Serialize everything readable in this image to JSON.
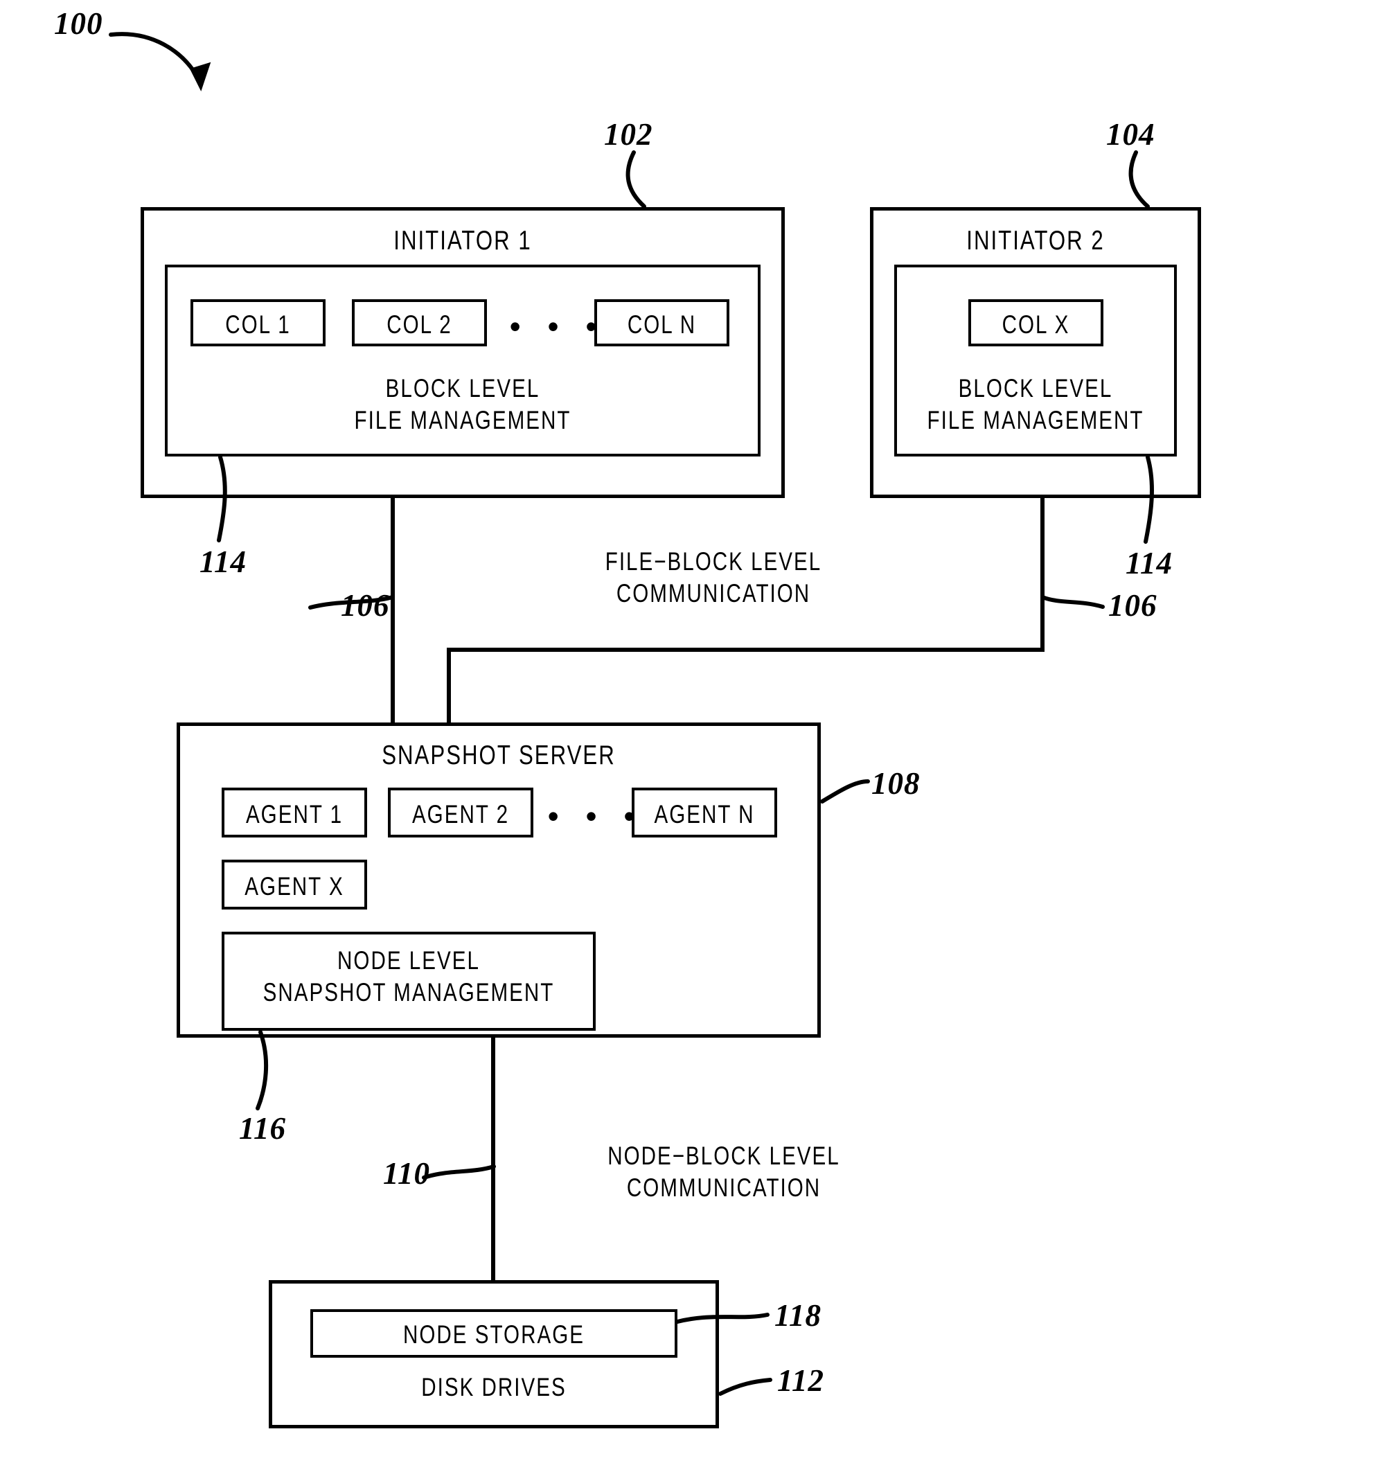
{
  "figure": {
    "figure_number": "100",
    "blocks": {
      "initiator1": {
        "title": "INITIATOR 1",
        "ref": "102",
        "inner_ref": "114",
        "inner_title_line1": "BLOCK LEVEL",
        "inner_title_line2": "FILE MANAGEMENT",
        "cols": [
          "COL 1",
          "COL 2",
          "COL N"
        ],
        "ellipsis": "• • •"
      },
      "initiator2": {
        "title": "INITIATOR 2",
        "ref": "104",
        "inner_ref": "114",
        "inner_title_line1": "BLOCK LEVEL",
        "inner_title_line2": "FILE MANAGEMENT",
        "cols": [
          "COL X"
        ]
      },
      "snapshot_server": {
        "title": "SNAPSHOT SERVER",
        "ref": "108",
        "agents": [
          "AGENT 1",
          "AGENT 2",
          "AGENT N"
        ],
        "agent_x": "AGENT X",
        "ellipsis": "• • •",
        "node_level_ref": "116",
        "node_level_line1": "NODE LEVEL",
        "node_level_line2": "SNAPSHOT MANAGEMENT"
      },
      "disk_drives": {
        "title": "DISK DRIVES",
        "ref": "112",
        "node_storage": "NODE STORAGE",
        "node_storage_ref": "118"
      }
    },
    "links": {
      "file_block": {
        "ref_left": "106",
        "ref_right": "106",
        "label_line1": "FILE−BLOCK LEVEL",
        "label_line2": "COMMUNICATION"
      },
      "node_block": {
        "ref": "110",
        "label_line1": "NODE−BLOCK LEVEL",
        "label_line2": "COMMUNICATION"
      }
    }
  }
}
